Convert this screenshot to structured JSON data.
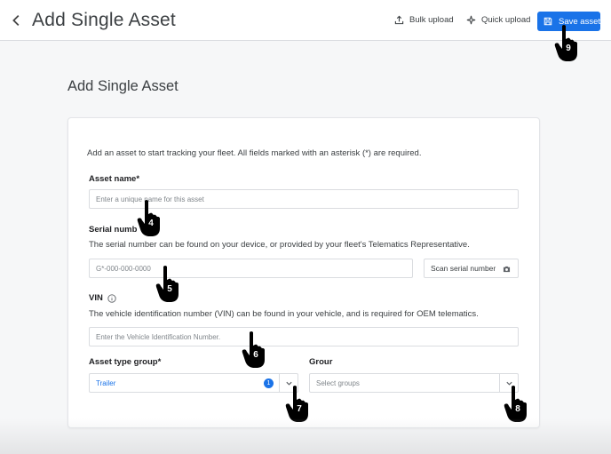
{
  "header": {
    "title": "Add Single Asset",
    "bulk_upload": "Bulk upload",
    "quick_upload": "Quick upload",
    "save_asset": "Save asset"
  },
  "section_title": "Add Single Asset",
  "form": {
    "intro": "Add an asset to start tracking your fleet. All fields marked with an asterisk (*) are required.",
    "asset_name": {
      "label": "Asset name*",
      "placeholder": "Enter a unique name for this asset"
    },
    "serial_number": {
      "label": "Serial numb",
      "help": "The serial number can be found on your device, or provided by your fleet's Telematics Representative.",
      "placeholder": "G*-000-000-0000",
      "scan_label": "Scan serial number"
    },
    "vin": {
      "label": "VIN",
      "help": "The vehicle identification number (VIN) can be found in your vehicle, and is required for OEM telematics.",
      "placeholder": "Enter the Vehicle Identification Number."
    },
    "asset_type_group": {
      "label": "Asset type group*",
      "value": "Trailer",
      "badge": "1"
    },
    "group": {
      "label": "Grour",
      "placeholder": "Select groups"
    }
  },
  "pointers": [
    "4",
    "5",
    "6",
    "7",
    "8",
    "9"
  ],
  "colors": {
    "accent": "#1a73e8",
    "pointer": "#000000"
  }
}
